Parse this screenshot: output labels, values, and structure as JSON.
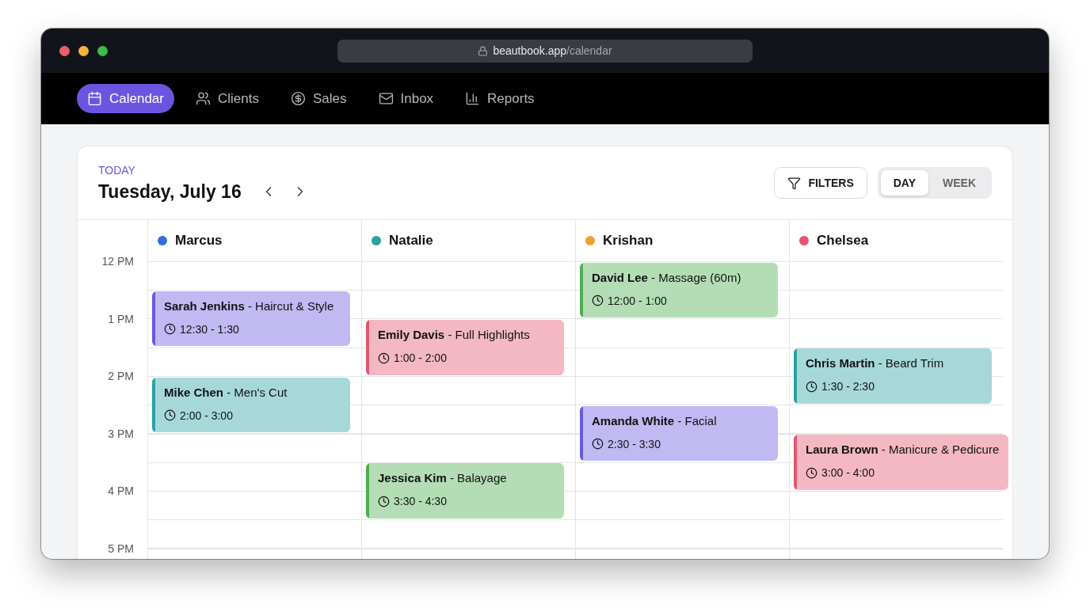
{
  "browser": {
    "url": {
      "host": "beautbook.app",
      "path": "/calendar"
    }
  },
  "nav": [
    {
      "label": "Calendar",
      "kind": "calendar",
      "selected": true
    },
    {
      "label": "Clients",
      "kind": "users",
      "selected": false
    },
    {
      "label": "Sales",
      "kind": "dollar",
      "selected": false
    },
    {
      "label": "Inbox",
      "kind": "mail",
      "selected": false
    },
    {
      "label": "Reports",
      "kind": "chart",
      "selected": false
    }
  ],
  "header": {
    "eyebrow": "TODAY",
    "date": "Tuesday, July 16",
    "filters": "FILTERS",
    "views": [
      {
        "label": "DAY",
        "selected": true
      },
      {
        "label": "WEEK",
        "selected": false
      }
    ]
  },
  "hours": [
    "12 PM",
    "1 PM",
    "2 PM",
    "3 PM",
    "4 PM",
    "5 PM"
  ],
  "staff": [
    {
      "name": "Marcus",
      "color": "#2f6fe0",
      "events": [
        {
          "title": "**Sarah Jenkins** - Haircut & Style",
          "time": "12:30 - 1:30",
          "color": "#6a58e0"
        },
        {
          "title": "**Mike Chen** - Men's Cut",
          "time": "2:00 - 3:00",
          "color": "#2aa1a4"
        }
      ]
    },
    {
      "name": "Natalie",
      "color": "#2aa1a4",
      "events": [
        {
          "title": "**Emily Davis** - Full Highlights",
          "time": "1:00 - 2:00",
          "color": "#e2566f"
        },
        {
          "title": "**Jessica Kim** - Balayage",
          "time": "3:30 - 4:30",
          "color": "#4caf50"
        }
      ]
    },
    {
      "name": "Krishan",
      "color": "#f0a030",
      "events": [
        {
          "title": "**David Lee** - Massage (60m)",
          "time": "12:00 - 1:00",
          "color": "#4caf50"
        },
        {
          "title": "**Amanda White** - Facial",
          "time": "2:30 - 3:30",
          "color": "#6a58e0"
        }
      ]
    },
    {
      "name": "Chelsea",
      "color": "#e2566f",
      "events": [
        {
          "title": "**Chris Martin** - Beard Trim",
          "time": "1:30 - 2:30",
          "color": "#2aa1a4"
        },
        {
          "title": "**Laura Brown** - Manicure & Pedicure",
          "time": "3:00 - 4:00",
          "color": "#e2566f"
        }
      ]
    }
  ]
}
